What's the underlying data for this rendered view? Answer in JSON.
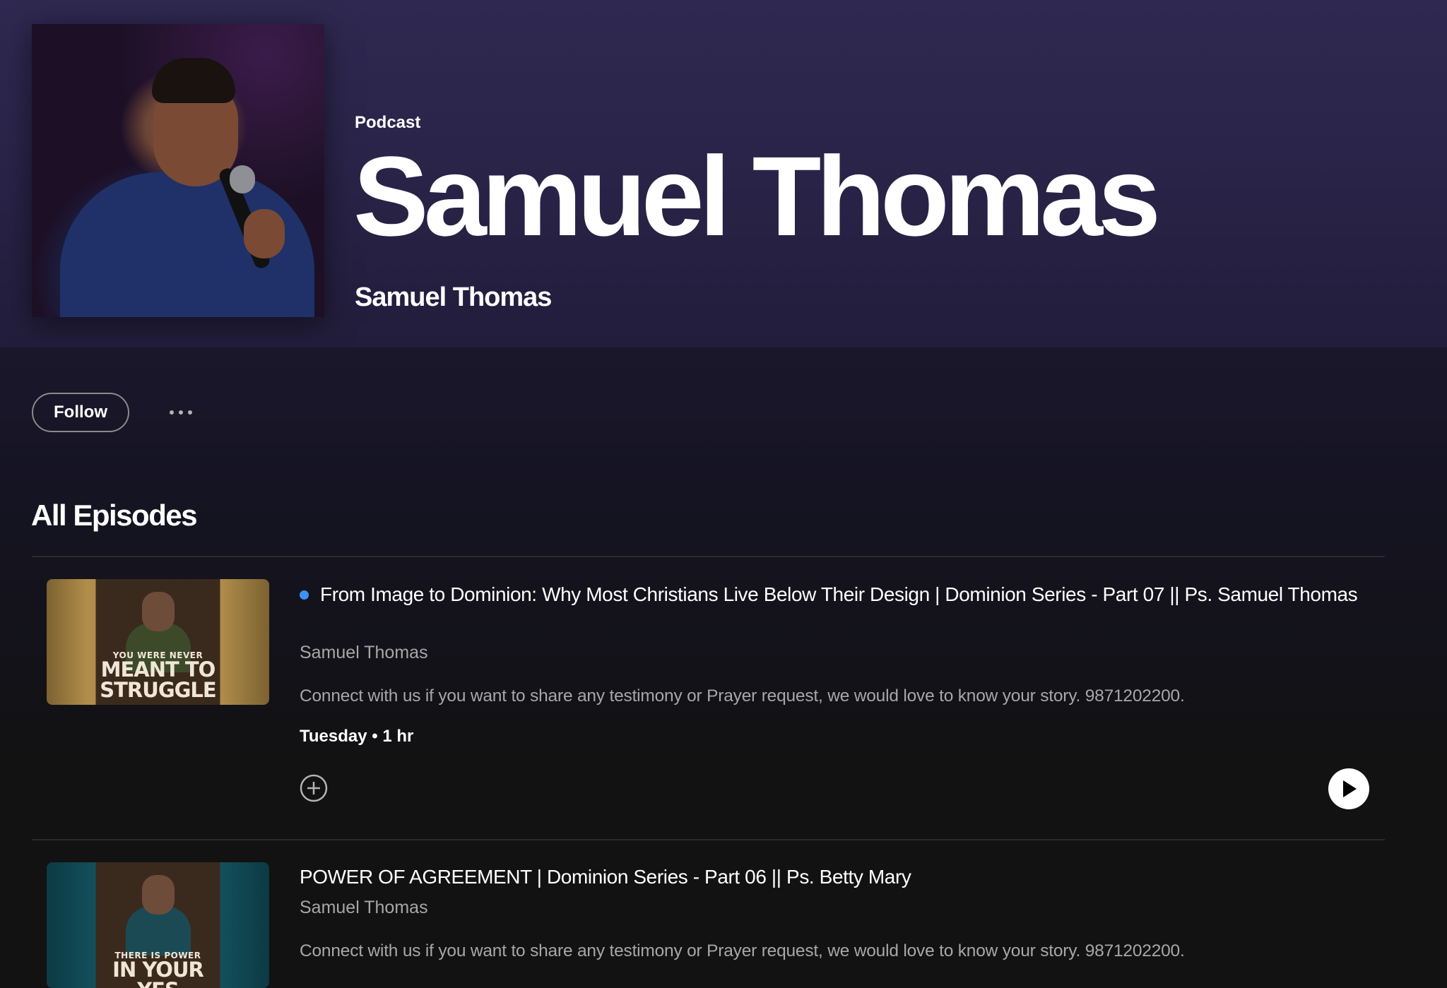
{
  "header": {
    "type_label": "Podcast",
    "title": "Samuel Thomas",
    "author": "Samuel Thomas",
    "background_color": "#2f2952"
  },
  "actions": {
    "follow_label": "Follow",
    "more_icon": "more-horizontal-icon"
  },
  "section": {
    "title": "All Episodes"
  },
  "episodes": [
    {
      "is_new": true,
      "new_dot_color": "#3d91f4",
      "title": "From Image to Dominion: Why Most Christians Live Below Their Design | Dominion Series - Part 07 || Ps. Samuel Thomas",
      "author": "Samuel Thomas",
      "description": "Connect with us if you want to share any testimony or Prayer request, we would love to know your story. 9871202200.",
      "meta": "Tuesday • 1 hr",
      "thumb_text_small": "YOU WERE NEVER",
      "thumb_text_big": "MEANT TO STRUGGLE",
      "add_icon": "add-circle-icon",
      "play_icon": "play-icon"
    },
    {
      "is_new": false,
      "title": "POWER OF AGREEMENT | Dominion Series - Part 06 || Ps. Betty Mary",
      "author": "Samuel Thomas",
      "description": "Connect with us if you want to share any testimony or Prayer request, we would love to know your story. 9871202200.",
      "thumb_text_small": "THERE IS POWER",
      "thumb_text_big": "IN YOUR YES"
    }
  ]
}
